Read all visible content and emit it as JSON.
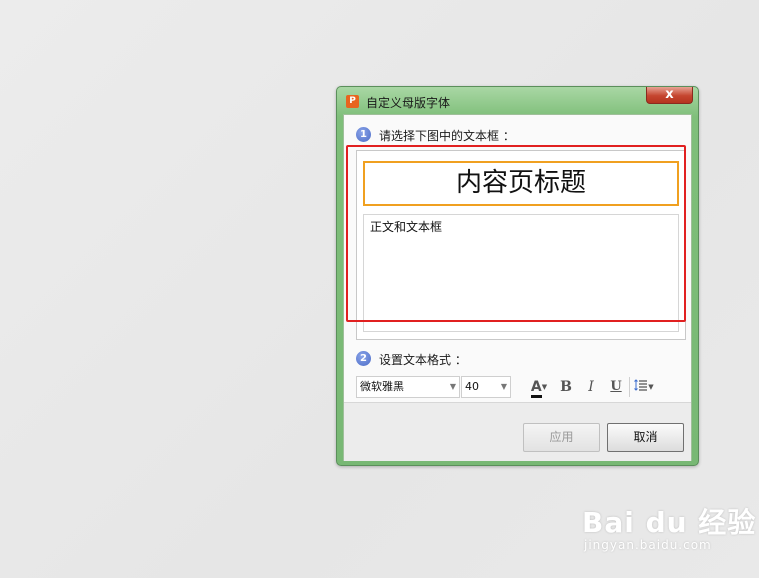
{
  "dialog": {
    "title": "自定义母版字体",
    "app_icon": "P",
    "close_glyph": "x"
  },
  "step1": {
    "number": "1",
    "label": "请选择下图中的文本框 ："
  },
  "preview": {
    "title_text": "内容页标题",
    "body_text": "正文和文本框"
  },
  "step2": {
    "number": "2",
    "label": "设置文本格式 ："
  },
  "format": {
    "font_value": "微软雅黑",
    "size_value": "40",
    "font_color_glyph": "A",
    "bold_glyph": "B",
    "italic_glyph": "I",
    "underline_glyph": "U",
    "accent_red": "#e12020",
    "title_box_color": "#f0a020"
  },
  "buttons": {
    "apply": "应用",
    "cancel": "取消"
  },
  "watermark": {
    "main": "Bai du 经验",
    "sub": "jingyan.baidu.com"
  }
}
